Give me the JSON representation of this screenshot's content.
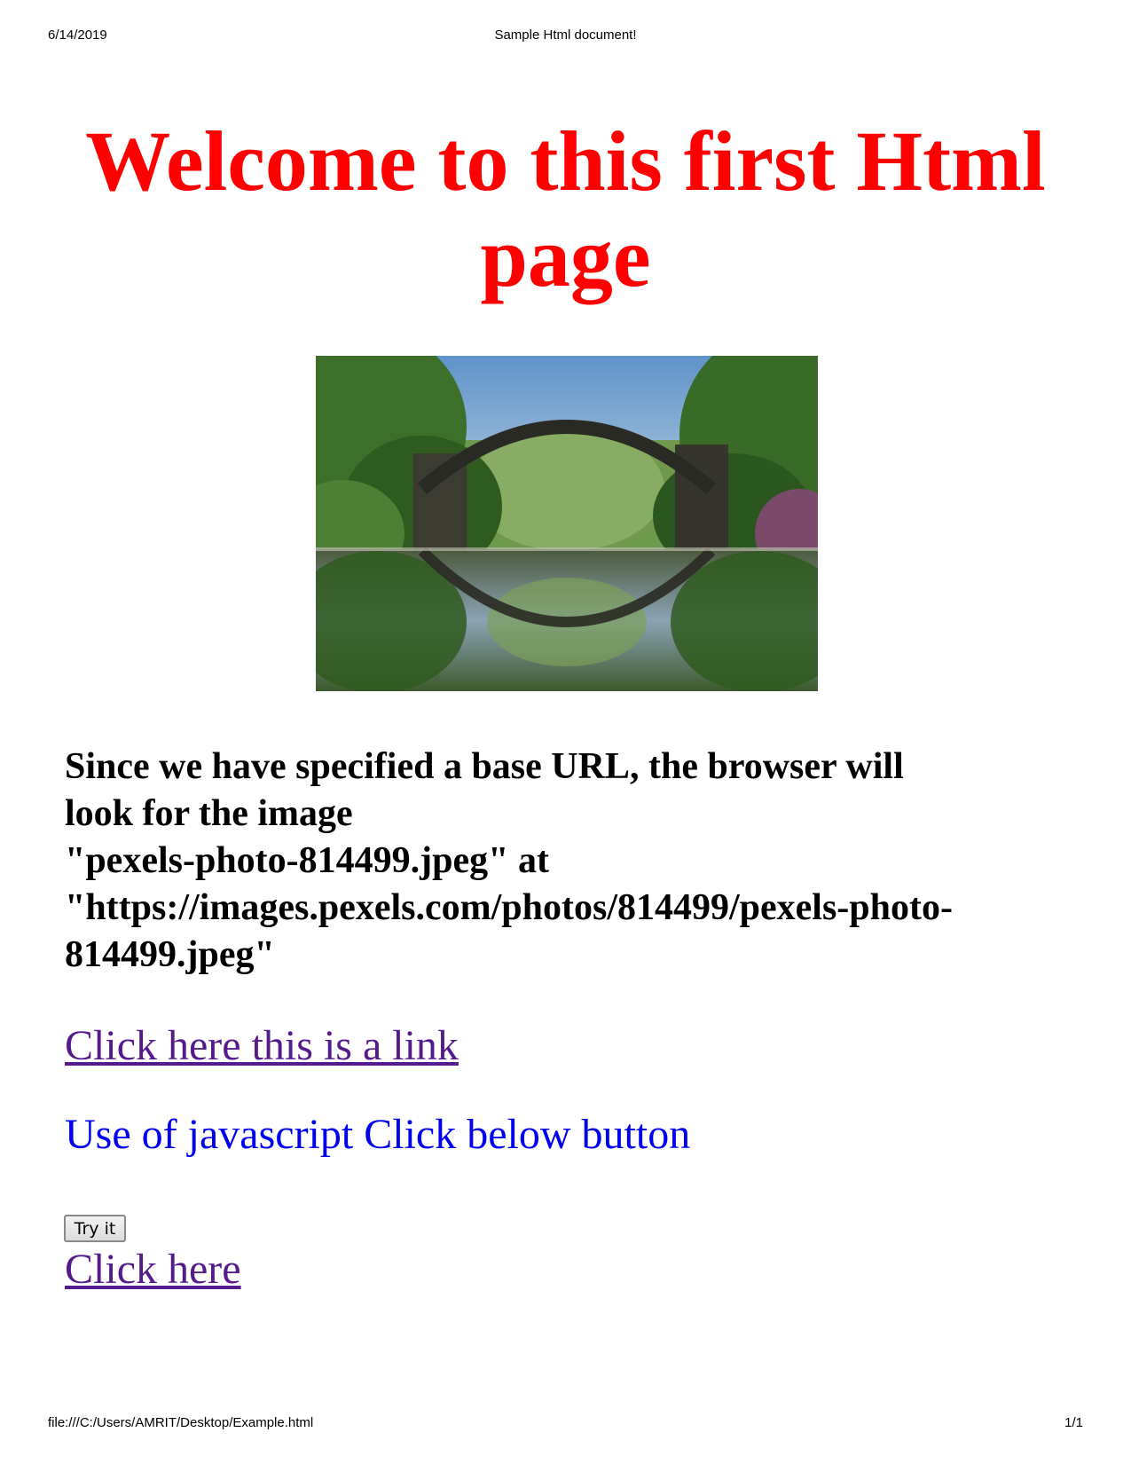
{
  "print_header": {
    "date": "6/14/2019",
    "title": "Sample Html document!"
  },
  "print_footer": {
    "url": "file:///C:/Users/AMRIT/Desktop/Example.html",
    "page": "1/1"
  },
  "heading": {
    "line1": "Welcome to this first Html",
    "line2": "page",
    "color": "#ff0000"
  },
  "photo": {
    "description_icon": "stone-arch-bridge-photo"
  },
  "info": {
    "lines": [
      "Since we have specified a base URL, the browser will",
      "look for the image",
      "\"pexels-photo-814499.jpeg\" at",
      "\"https://images.pexels.com/photos/814499/pexels-photo-",
      "814499.jpeg\""
    ]
  },
  "link_main": {
    "label": "Click here this is a link",
    "color": "#551a8b"
  },
  "js_text": {
    "label": "Use of javascript Click below button",
    "color": "#0000ee"
  },
  "button": {
    "label": "Try it"
  },
  "link_second": {
    "label": "Click here",
    "color": "#551a8b"
  }
}
